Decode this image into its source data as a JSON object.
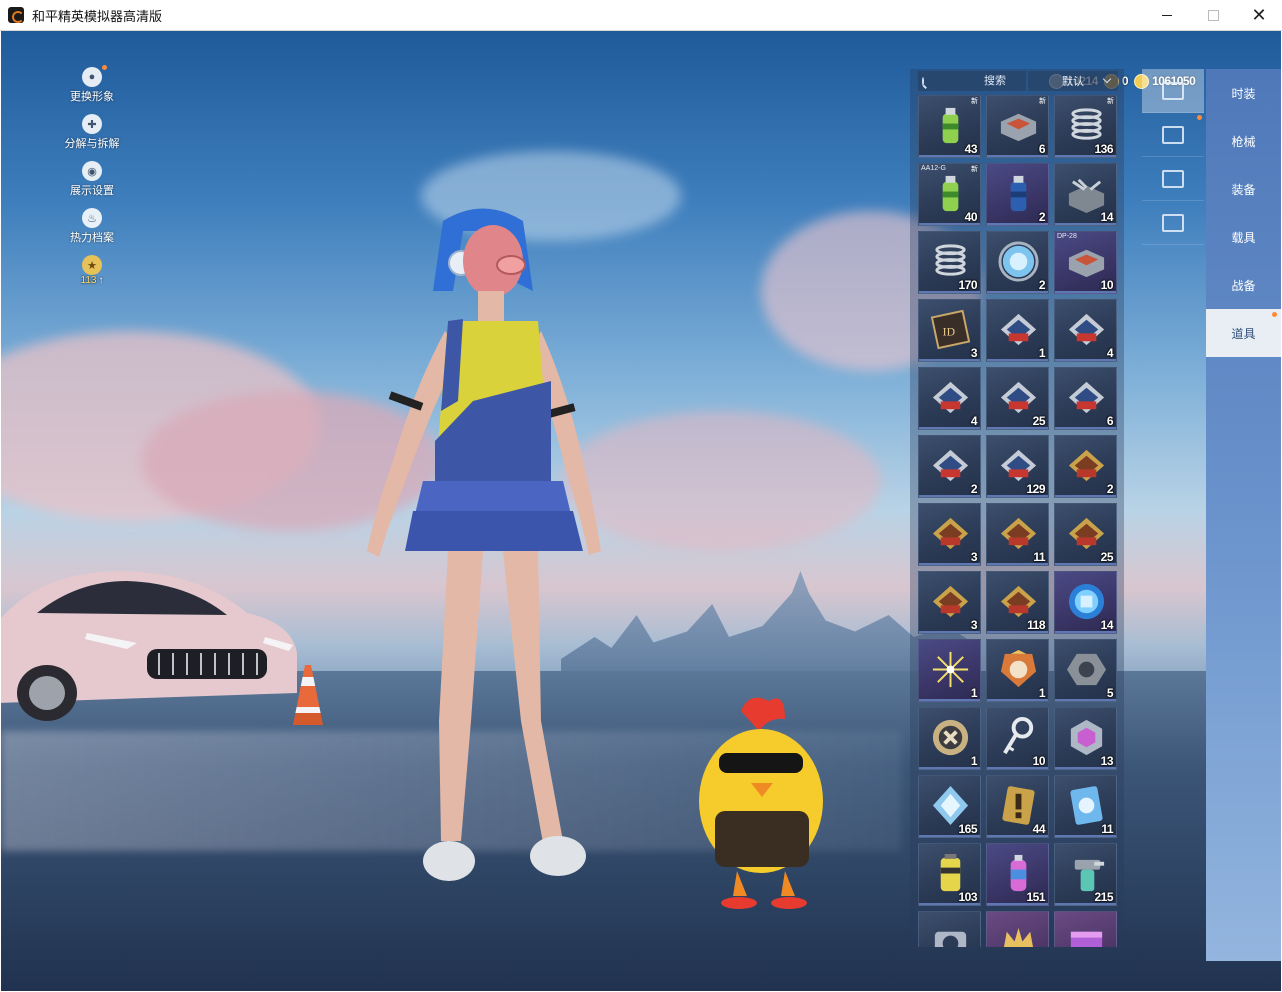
{
  "window": {
    "title": "和平精英模拟器高清版",
    "close_glyph": "✕"
  },
  "left_menu": [
    {
      "label": "更换形象",
      "icon": "avatar-icon"
    },
    {
      "label": "分解与拆解",
      "icon": "puzzle-icon"
    },
    {
      "label": "展示设置",
      "icon": "eye-icon"
    },
    {
      "label": "热力档案",
      "icon": "flame-icon"
    }
  ],
  "level": {
    "value": "113"
  },
  "currency": [
    {
      "icon": "silver-coin-icon",
      "value": "10214",
      "color": "#9aa7b8"
    },
    {
      "icon": "gold-coin-icon",
      "value": "0",
      "color": "#d9a53a"
    },
    {
      "icon": "diamond-coin-icon",
      "value": "1061050",
      "color": "#f1cc58"
    }
  ],
  "inventory": {
    "search_placeholder": "搜索",
    "sort_label": "默认",
    "items": [
      {
        "count": "43",
        "tag": "新",
        "art": "spray-can",
        "tone": "default"
      },
      {
        "count": "6",
        "tag": "新",
        "art": "crate",
        "tone": "default"
      },
      {
        "count": "136",
        "tag": "新",
        "art": "spring",
        "tone": "default"
      },
      {
        "count": "40",
        "tag": "新",
        "art": "spray-can",
        "tone": "default",
        "prefix": "AA12-G"
      },
      {
        "count": "2",
        "art": "spray-can-blue",
        "tone": "rare"
      },
      {
        "count": "14",
        "art": "crate-open",
        "tone": "default"
      },
      {
        "count": "170",
        "art": "spring",
        "tone": "default"
      },
      {
        "count": "2",
        "art": "orb-blue",
        "tone": "default"
      },
      {
        "count": "10",
        "art": "crate",
        "tone": "rare",
        "prefix": "DP-28"
      },
      {
        "count": "3",
        "art": "id-card",
        "tone": "default"
      },
      {
        "count": "1",
        "art": "ticket-red",
        "tone": "default"
      },
      {
        "count": "4",
        "art": "ticket-red",
        "tone": "default"
      },
      {
        "count": "4",
        "art": "ticket-red",
        "tone": "default"
      },
      {
        "count": "25",
        "art": "ticket-red",
        "tone": "default"
      },
      {
        "count": "6",
        "art": "ticket-red",
        "tone": "default"
      },
      {
        "count": "2",
        "art": "ticket-red",
        "tone": "default"
      },
      {
        "count": "129",
        "art": "ticket-red",
        "tone": "default"
      },
      {
        "count": "2",
        "art": "ticket-gold",
        "tone": "default"
      },
      {
        "count": "3",
        "art": "ticket-gold",
        "tone": "default"
      },
      {
        "count": "11",
        "art": "ticket-gold",
        "tone": "default"
      },
      {
        "count": "25",
        "art": "ticket-gold",
        "tone": "default"
      },
      {
        "count": "3",
        "art": "ticket-gold",
        "tone": "default"
      },
      {
        "count": "118",
        "art": "ticket-gold",
        "tone": "default"
      },
      {
        "count": "14",
        "art": "orb-puzzle",
        "tone": "rare"
      },
      {
        "count": "1",
        "art": "firework",
        "tone": "rare"
      },
      {
        "count": "1",
        "art": "badge",
        "tone": "default"
      },
      {
        "count": "5",
        "art": "nut",
        "tone": "default"
      },
      {
        "count": "1",
        "art": "medal",
        "tone": "default"
      },
      {
        "count": "10",
        "art": "key",
        "tone": "default"
      },
      {
        "count": "13",
        "art": "gem-hex",
        "tone": "default"
      },
      {
        "count": "165",
        "art": "diamond",
        "tone": "default"
      },
      {
        "count": "44",
        "art": "exclaim-card",
        "tone": "default"
      },
      {
        "count": "11",
        "art": "card-blue",
        "tone": "default"
      },
      {
        "count": "103",
        "art": "canister",
        "tone": "default"
      },
      {
        "count": "151",
        "art": "spray-pink",
        "tone": "rare"
      },
      {
        "count": "215",
        "art": "spray-gun",
        "tone": "default"
      },
      {
        "count": "",
        "art": "camera",
        "tone": "default"
      },
      {
        "count": "",
        "art": "crown",
        "tone": "epic"
      },
      {
        "count": "",
        "art": "box-purple",
        "tone": "epic"
      }
    ]
  },
  "tabs": [
    {
      "icon": "card-icon",
      "active": true
    },
    {
      "icon": "calendar-icon",
      "active": false,
      "dot": true
    },
    {
      "icon": "sparkle-icon",
      "active": false
    },
    {
      "icon": "ticket-icon",
      "active": false
    }
  ],
  "categories": [
    {
      "label": "时装",
      "active": false
    },
    {
      "label": "枪械",
      "active": false
    },
    {
      "label": "装备",
      "active": false
    },
    {
      "label": "载具",
      "active": false
    },
    {
      "label": "战备",
      "active": false
    },
    {
      "label": "道具",
      "active": true,
      "dot": true
    }
  ]
}
